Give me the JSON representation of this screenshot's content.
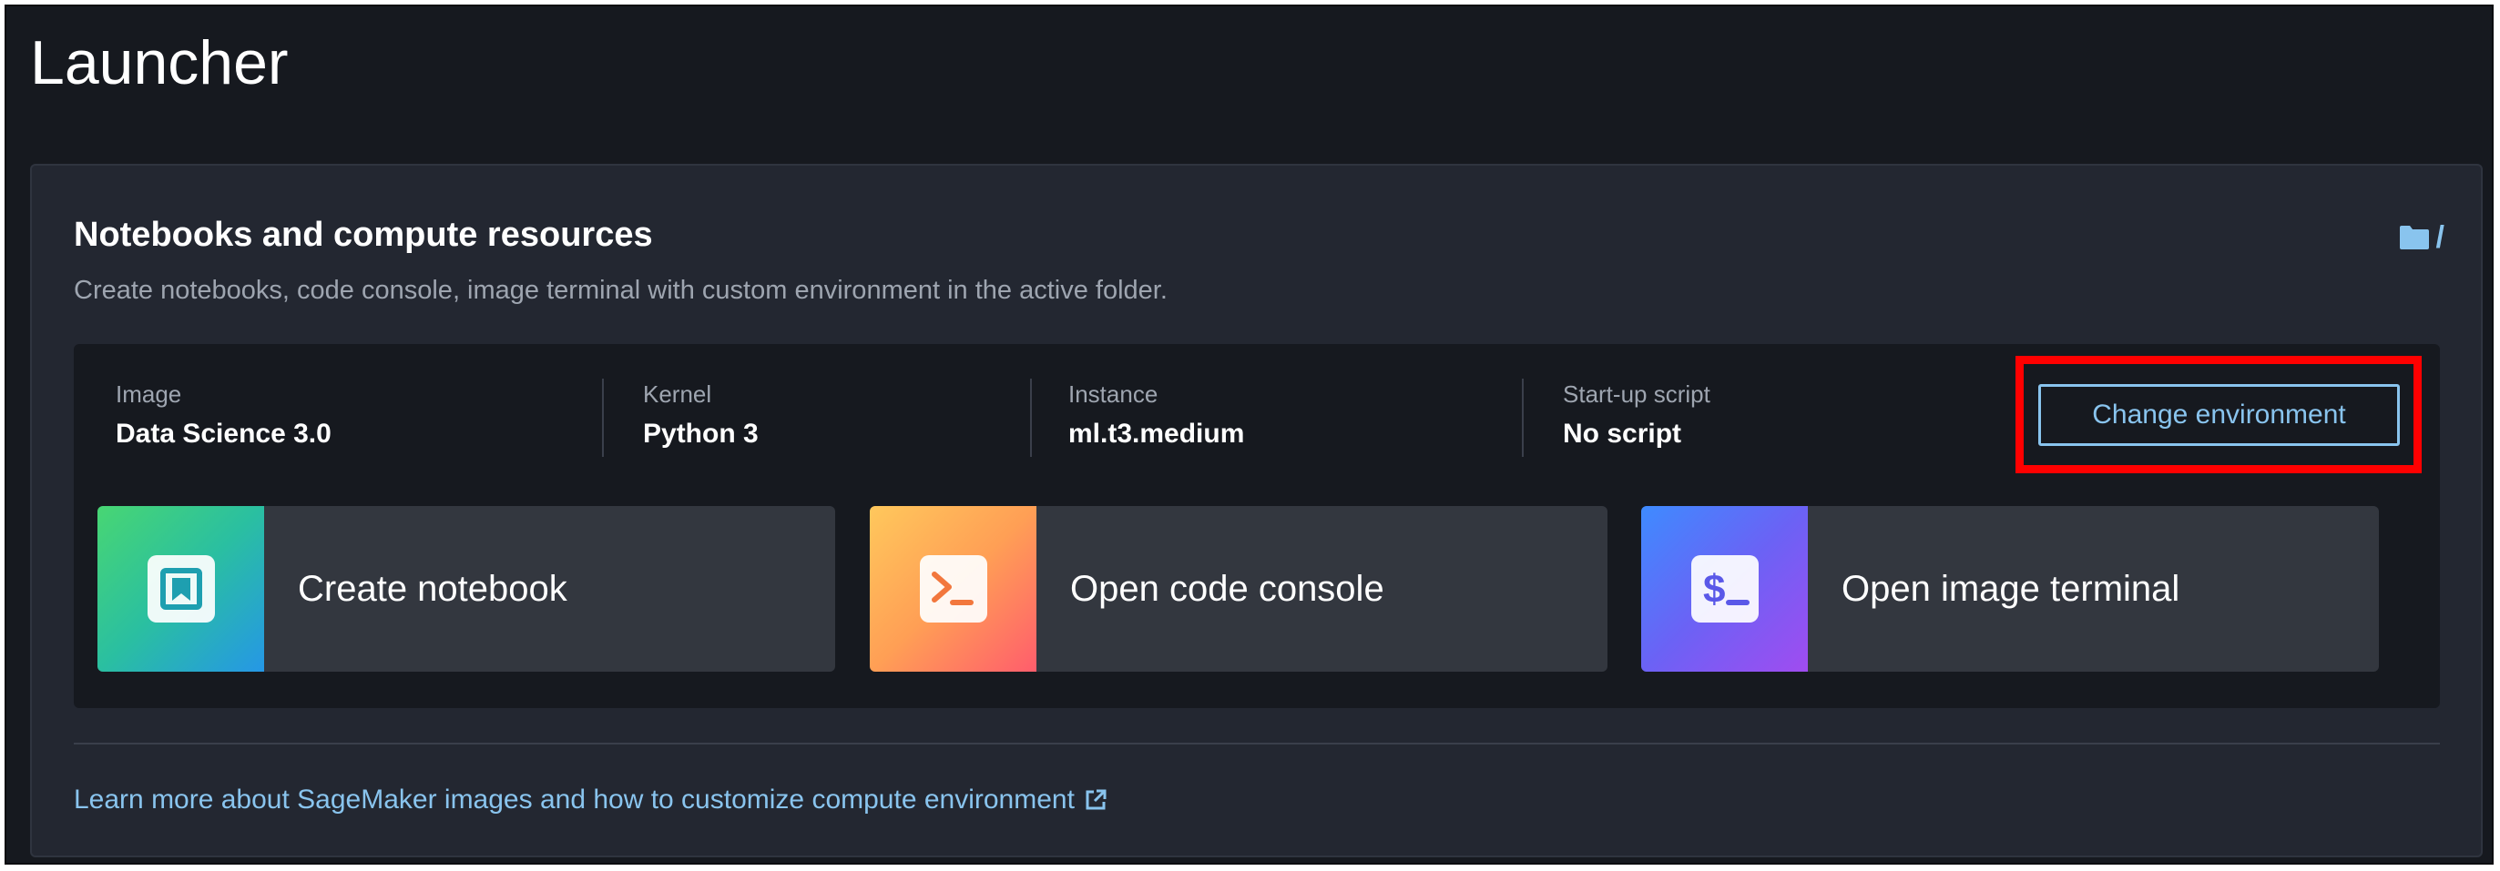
{
  "page": {
    "title": "Launcher"
  },
  "section": {
    "title": "Notebooks and compute resources",
    "subtitle": "Create notebooks, code console, image terminal with custom environment in the active folder.",
    "folder_path": "/"
  },
  "environment": {
    "image": {
      "label": "Image",
      "value": "Data Science 3.0"
    },
    "kernel": {
      "label": "Kernel",
      "value": "Python 3"
    },
    "instance": {
      "label": "Instance",
      "value": "ml.t3.medium"
    },
    "startup_script": {
      "label": "Start-up script",
      "value": "No script"
    },
    "change_button_label": "Change environment",
    "highlight_color": "#ff0000"
  },
  "cards": [
    {
      "label": "Create notebook",
      "icon": "notebook-icon"
    },
    {
      "label": "Open code console",
      "icon": "console-icon"
    },
    {
      "label": "Open image terminal",
      "icon": "terminal-icon"
    }
  ],
  "footer": {
    "learn_more_label": "Learn more about SageMaker images and how to customize compute environment",
    "external_icon": "external-link-icon"
  },
  "colors": {
    "background": "#16191f",
    "panel": "#232731",
    "link": "#89c4ee",
    "card": "#33373f"
  }
}
